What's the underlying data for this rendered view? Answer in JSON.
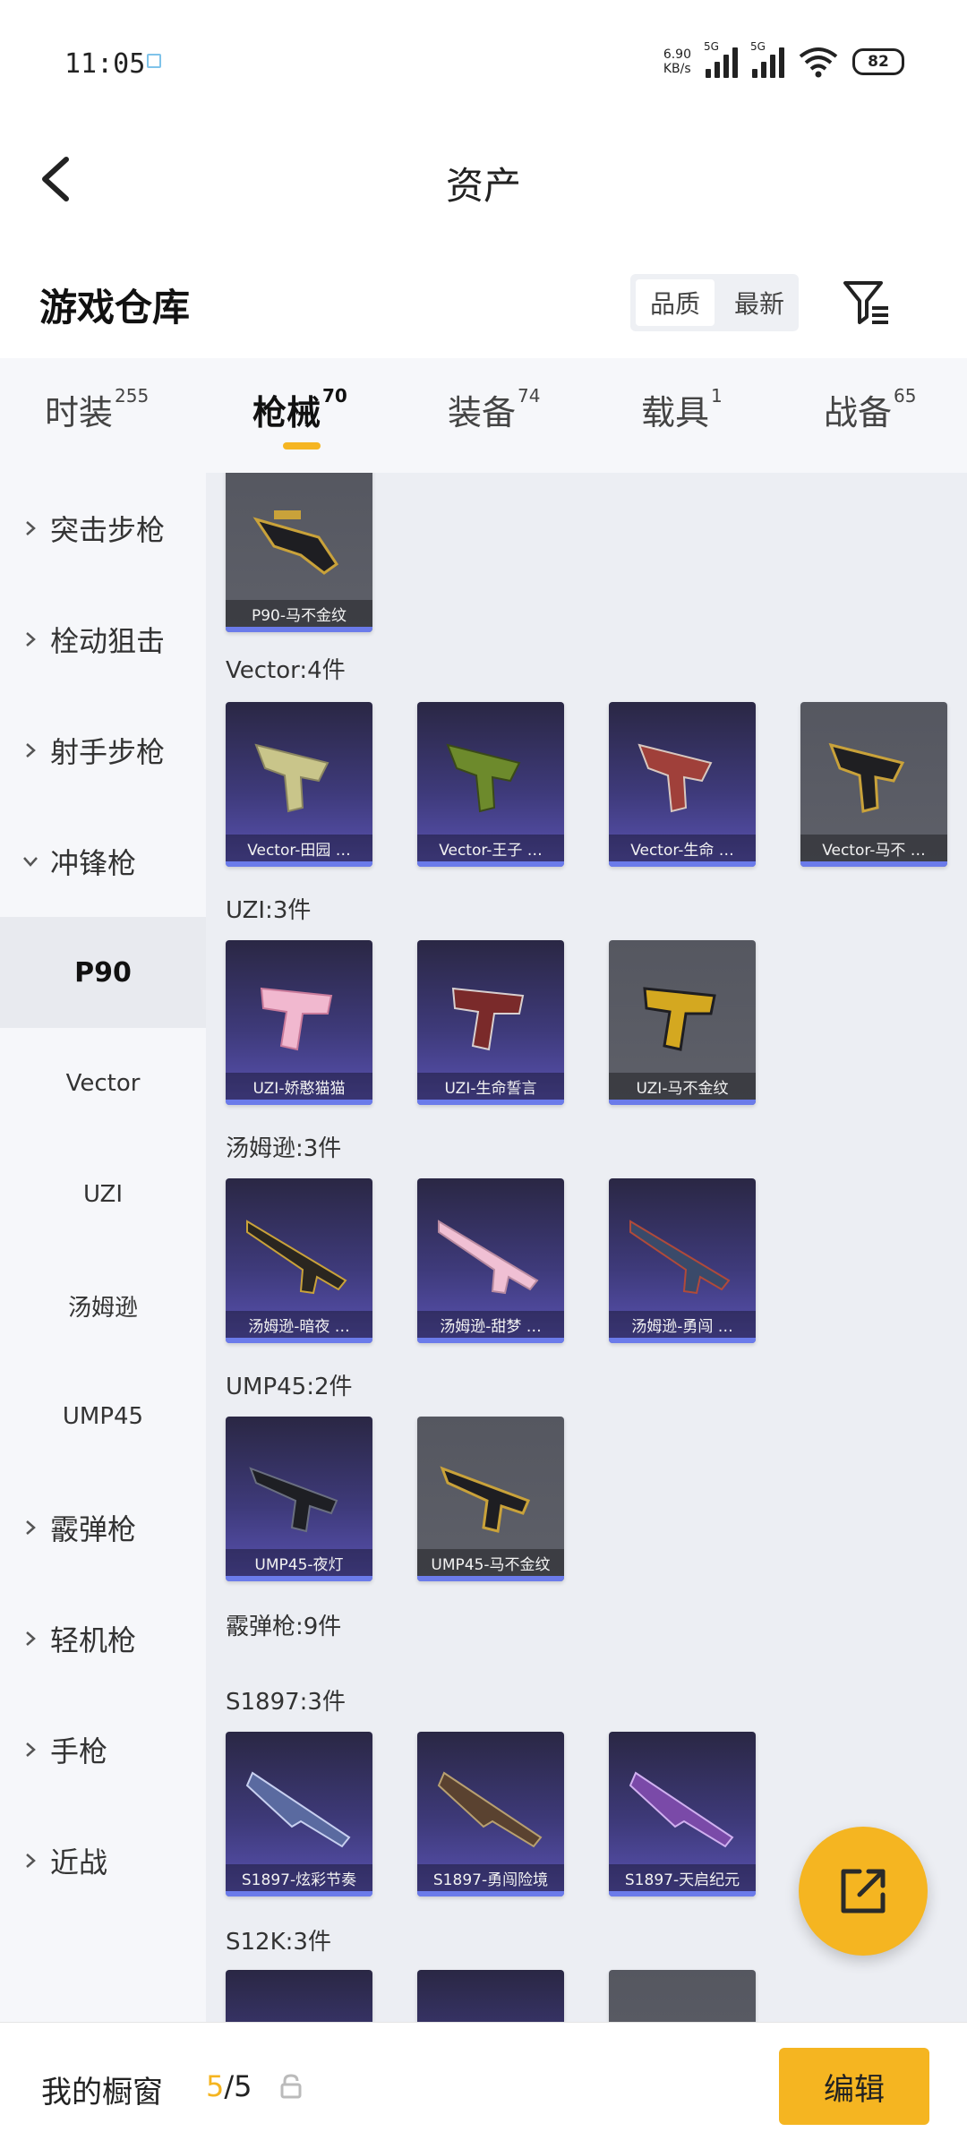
{
  "status_bar": {
    "time": "11:05",
    "net_speed_value": "6.90",
    "net_speed_unit": "KB/s",
    "signal1_tag": "5G",
    "signal2_tag": "5G",
    "battery": "82"
  },
  "header": {
    "title": "资产"
  },
  "warehouse": {
    "title": "游戏仓库",
    "sort_quality": "品质",
    "sort_newest": "最新"
  },
  "tabs": [
    {
      "label": "时装",
      "count": "255"
    },
    {
      "label": "枪械",
      "count": "70"
    },
    {
      "label": "装备",
      "count": "74"
    },
    {
      "label": "载具",
      "count": "1"
    },
    {
      "label": "战备",
      "count": "65"
    }
  ],
  "sidebar": {
    "items": [
      {
        "label": "突击步枪"
      },
      {
        "label": "栓动狙击"
      },
      {
        "label": "射手步枪"
      },
      {
        "label": "冲锋枪"
      },
      {
        "label": "P90"
      },
      {
        "label": "Vector"
      },
      {
        "label": "UZI"
      },
      {
        "label": "汤姆逊"
      },
      {
        "label": "UMP45"
      },
      {
        "label": "霰弹枪"
      },
      {
        "label": "轻机枪"
      },
      {
        "label": "手枪"
      },
      {
        "label": "近战"
      }
    ]
  },
  "groups": {
    "p90": {
      "cards": [
        {
          "name": "P90-马不金纹"
        }
      ]
    },
    "vector": {
      "label": "Vector:4件",
      "cards": [
        {
          "name": "Vector-田园 …"
        },
        {
          "name": "Vector-王子 …"
        },
        {
          "name": "Vector-生命 …"
        },
        {
          "name": "Vector-马不 …"
        }
      ]
    },
    "uzi": {
      "label": "UZI:3件",
      "cards": [
        {
          "name": "UZI-娇憨猫猫"
        },
        {
          "name": "UZI-生命誓言"
        },
        {
          "name": "UZI-马不金纹"
        }
      ]
    },
    "thompson": {
      "label": "汤姆逊:3件",
      "cards": [
        {
          "name": "汤姆逊-暗夜 …"
        },
        {
          "name": "汤姆逊-甜梦 …"
        },
        {
          "name": "汤姆逊-勇闯 …"
        }
      ]
    },
    "ump45": {
      "label": "UMP45:2件",
      "cards": [
        {
          "name": "UMP45-夜灯"
        },
        {
          "name": "UMP45-马不金纹"
        }
      ]
    },
    "shotgun": {
      "label": "霰弹枪:9件"
    },
    "s1897": {
      "label": "S1897:3件",
      "cards": [
        {
          "name": "S1897-炫彩节奏"
        },
        {
          "name": "S1897-勇闯险境"
        },
        {
          "name": "S1897-天启纪元"
        }
      ]
    },
    "s12k": {
      "label": "S12K:3件"
    }
  },
  "bottom_bar": {
    "label": "我的橱窗",
    "count_current": "5",
    "count_total": "/5",
    "edit": "编辑"
  }
}
